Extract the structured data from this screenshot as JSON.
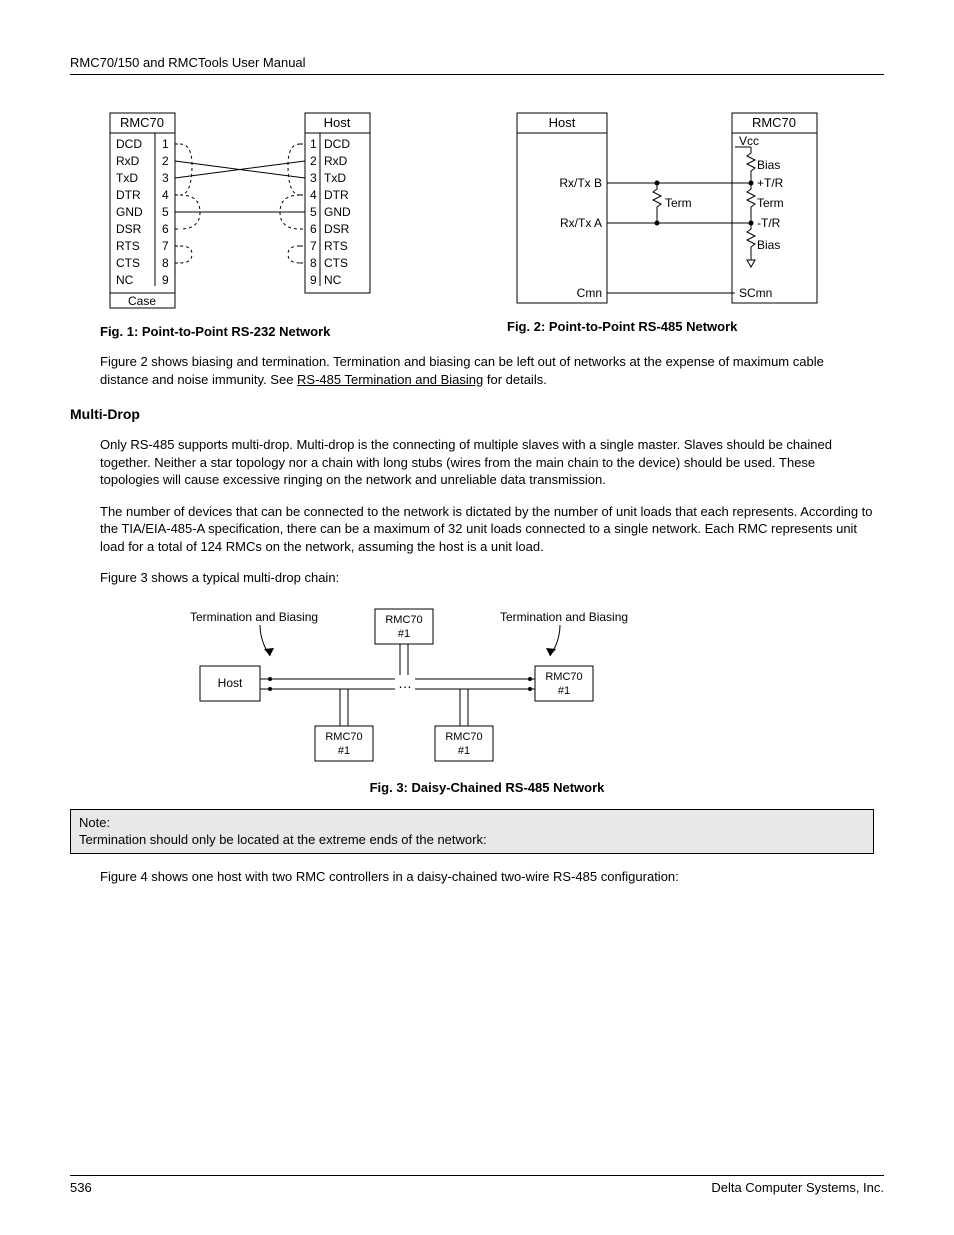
{
  "header": {
    "title": "RMC70/150 and RMCTools User Manual"
  },
  "fig1": {
    "caption": "Fig. 1: Point-to-Point RS-232 Network",
    "left_title": "RMC70",
    "right_title": "Host",
    "case_label": "Case",
    "pins": [
      {
        "num": "1",
        "lname": "DCD",
        "rname": "DCD"
      },
      {
        "num": "2",
        "lname": "RxD",
        "rname": "RxD"
      },
      {
        "num": "3",
        "lname": "TxD",
        "rname": "TxD"
      },
      {
        "num": "4",
        "lname": "DTR",
        "rname": "DTR"
      },
      {
        "num": "5",
        "lname": "GND",
        "rname": "GND"
      },
      {
        "num": "6",
        "lname": "DSR",
        "rname": "DSR"
      },
      {
        "num": "7",
        "lname": "RTS",
        "rname": "RTS"
      },
      {
        "num": "8",
        "lname": "CTS",
        "rname": "CTS"
      },
      {
        "num": "9",
        "lname": "NC",
        "rname": "NC"
      }
    ]
  },
  "fig2": {
    "caption": "Fig. 2: Point-to-Point RS-485 Network",
    "left_title": "Host",
    "right_title": "RMC70",
    "left_labels": {
      "b": "Rx/Tx B",
      "a": "Rx/Tx A",
      "cmn": "Cmn"
    },
    "right_labels": {
      "vcc": "Vcc",
      "bias1": "Bias",
      "tr_p": "+T/R",
      "term": "Term",
      "tr_n": "-T/R",
      "bias2": "Bias",
      "scmn": "SCmn"
    },
    "term_label": "Term"
  },
  "body": {
    "p1a": "Figure 2 shows biasing and termination. Termination and biasing can be left out of networks at the expense of maximum cable distance and noise immunity. See ",
    "p1_link": "RS-485 Termination and Biasing",
    "p1b": " for details.",
    "h_multidrop": "Multi-Drop",
    "p2": "Only RS-485 supports multi-drop. Multi-drop is the connecting of multiple slaves with a single master. Slaves should be chained together. Neither a star topology nor a chain with long stubs (wires from the main chain to the device) should be used. These topologies will cause excessive ringing on the network and unreliable data transmission.",
    "p3": "The number of devices that can be connected to the network is dictated by the number of unit loads that each represents. According to the TIA/EIA-485-A specification, there can be a maximum of 32 unit loads connected to a single network. Each RMC represents unit load for a total of 124 RMCs on the network, assuming the host is a unit load.",
    "p4": "Figure 3 shows a typical multi-drop chain:"
  },
  "fig3": {
    "caption": "Fig. 3: Daisy-Chained RS-485 Network",
    "term_left": "Termination and Biasing",
    "term_right": "Termination and Biasing",
    "host": "Host",
    "box_top": "RMC70\n#1",
    "box_right": "RMC70\n#1",
    "box_b1": "RMC70\n#1",
    "box_b2": "RMC70\n#1"
  },
  "note": {
    "label": "Note:",
    "text": "Termination should only be located at the extreme ends of the network:"
  },
  "body2": {
    "p5": "Figure 4 shows one host with two RMC controllers in a daisy-chained two-wire RS-485 configuration:"
  },
  "footer": {
    "page": "536",
    "company": "Delta Computer Systems, Inc."
  }
}
